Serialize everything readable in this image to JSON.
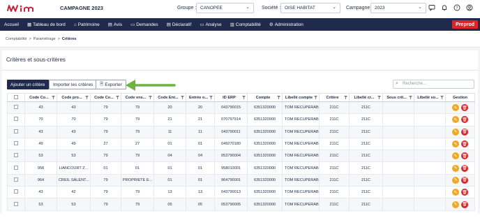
{
  "header": {
    "campaign_title": "CAMPAGNE 2023",
    "groupe_label": "Groupe :",
    "groupe_value": "CANOPEE",
    "societe_label": "Société :",
    "societe_value": "OISE HABITAT",
    "campagne_label": "Campagne :",
    "campagne_value": "2023",
    "icons": [
      "chat-icon",
      "bell-icon",
      "help-icon",
      "user-icon"
    ]
  },
  "nav": {
    "items": [
      {
        "label": "Accueil",
        "icon": ""
      },
      {
        "label": "Tableau de bord",
        "icon": "dashboard-icon"
      },
      {
        "label": "Patrimoine",
        "icon": "building-icon"
      },
      {
        "label": "Avis",
        "icon": "document-icon"
      },
      {
        "label": "Demandes",
        "icon": "folder-icon"
      },
      {
        "label": "Déclaratif",
        "icon": "file-icon"
      },
      {
        "label": "Analyse",
        "icon": "chart-icon"
      },
      {
        "label": "Comptabilité",
        "icon": "ledger-icon"
      },
      {
        "label": "Administration",
        "icon": "gear-icon"
      }
    ],
    "env_badge": "Preprod"
  },
  "breadcrumb": {
    "items": [
      "Comptabilité",
      "Paramétrage",
      "Critères"
    ],
    "separator": ">"
  },
  "page": {
    "title": "Critères et sous-critères",
    "add_button": "Ajouter un critère",
    "import_button": "Importer les critères",
    "export_button": "Exporter",
    "search_placeholder": "Recherche..."
  },
  "table": {
    "columns": [
      "",
      "Code Co...",
      "Code pro...",
      "Code Co...",
      "Code ens...",
      "Code Ent...",
      "Entrée o...",
      "ID ERP",
      "Compte",
      "Libellé compte",
      "Critère",
      "Libellé cr...",
      "Sous crit...",
      "Libellé so...",
      "Gestion"
    ],
    "rows": [
      [
        "43",
        "43",
        "79",
        "79",
        "20",
        "20",
        "043790015",
        "6351320000",
        "TOM RECUPERAB",
        "211C",
        "211C",
        "",
        ""
      ],
      [
        "70",
        "70",
        "79",
        "79",
        "21",
        "21",
        "070797914",
        "6351320000",
        "TOM RECUPERAB",
        "211C",
        "211C",
        "",
        ""
      ],
      [
        "43",
        "43",
        "79",
        "79",
        "11",
        "11",
        "043790011",
        "6351320000",
        "TOM RECUPERAB",
        "211C",
        "211C",
        "",
        ""
      ],
      [
        "49",
        "49",
        "27",
        "27",
        "01",
        "01",
        "049270180",
        "6351320000",
        "TOM RECUPERAB",
        "211C",
        "211C",
        "",
        ""
      ],
      [
        "53",
        "53",
        "79",
        "79",
        "04",
        "04",
        "053790004",
        "6351320000",
        "TOM RECUPERAB",
        "211C",
        "211C",
        "",
        ""
      ],
      [
        "958",
        "LIANCOURT Z...",
        "01",
        "01",
        "01",
        "01",
        "958010001",
        "6351320000",
        "TOM RECUPERAB",
        "211C",
        "211C",
        "",
        ""
      ],
      [
        "964",
        "CREIL SALENT...",
        "79",
        "PROPRIETE E...",
        "01",
        "01",
        "964790001",
        "6351320000",
        "TOM RECUPERAB",
        "211C",
        "211C",
        "",
        ""
      ],
      [
        "43",
        "42",
        "79",
        "79",
        "13",
        "13",
        "043790013",
        "6351320000",
        "TOM RECUPERAB",
        "211C",
        "211C",
        "",
        ""
      ],
      [
        "53",
        "53",
        "79",
        "79",
        "05",
        "05",
        "053790005",
        "6351320000",
        "TOM RECUPERAB",
        "211C",
        "211C",
        "",
        ""
      ]
    ]
  },
  "colors": {
    "nav_bg": "#1f2a4d",
    "preprod": "#d8262c",
    "edit": "#f0a823",
    "delete": "#d8262c",
    "arrow": "#6db33f"
  }
}
